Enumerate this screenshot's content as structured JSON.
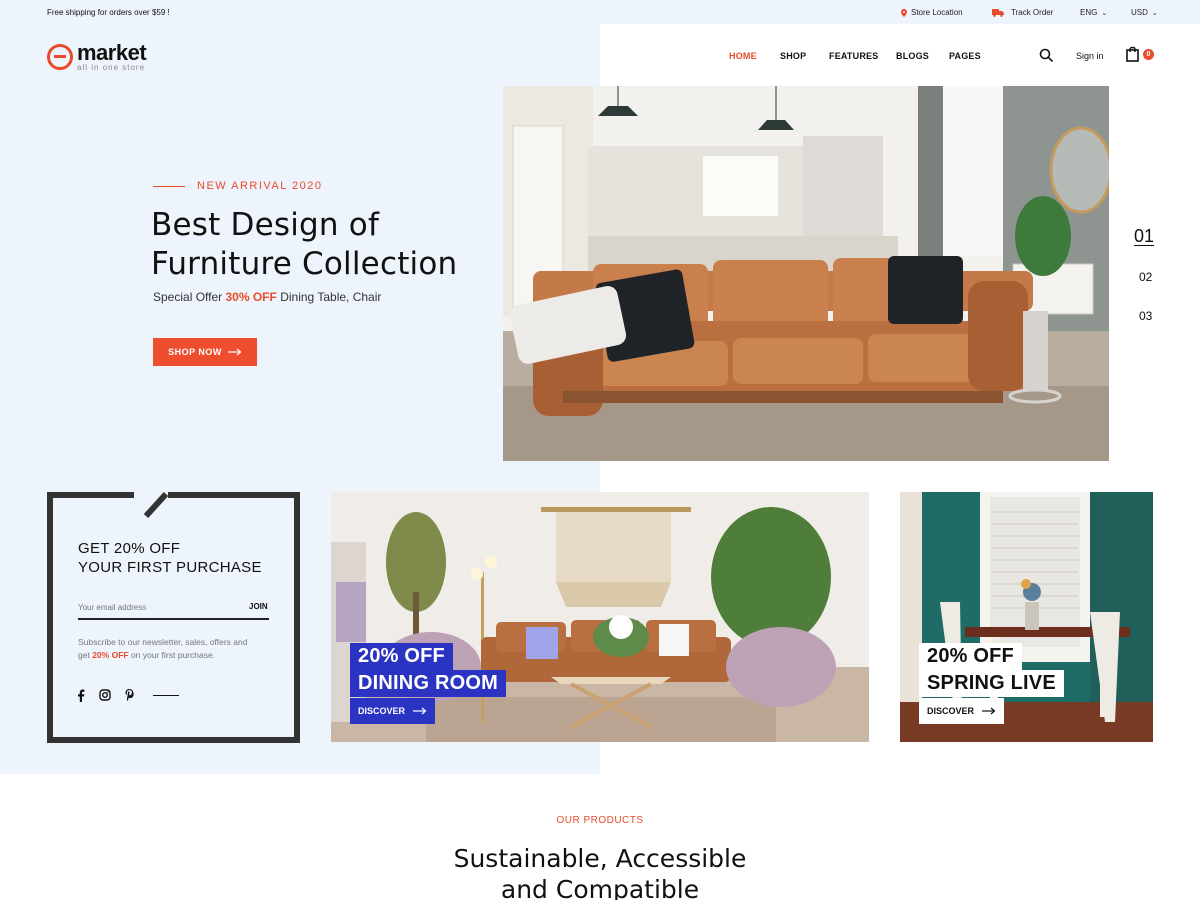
{
  "topbar": {
    "shipping": "Free shipping for orders over $59 !",
    "store_location": "Store Location",
    "track_order": "Track Order",
    "language": "ENG",
    "currency": "USD"
  },
  "header": {
    "logo_word": "market",
    "logo_tagline": "all in one store",
    "nav": [
      "HOME",
      "SHOP",
      "FEATURES",
      "BLOGS",
      "PAGES"
    ],
    "active_nav": "HOME",
    "sign_in": "Sign in",
    "cart_count": "0"
  },
  "hero": {
    "eyebrow": "NEW ARRIVAL 2020",
    "title_line1": "Best Design of",
    "title_line2": "Furniture Collection",
    "subtitle_prefix": "Special Offer",
    "subtitle_highlight": "30% OFF",
    "subtitle_suffix": "Dining Table, Chair",
    "cta": "SHOP NOW",
    "slides": [
      "01",
      "02",
      "03"
    ],
    "active_slide": "01"
  },
  "newsletter": {
    "title_line1": "GET 20% OFF",
    "title_line2": "YOUR FIRST PURCHASE",
    "email_placeholder": "Your email address",
    "join": "JOIN",
    "desc_line1": "Subscribe to our newsletter, sales, offers and",
    "desc_prefix": "get",
    "desc_highlight": "20% OFF",
    "desc_suffix": "on your first purchase.",
    "socials": [
      "facebook-icon",
      "instagram-icon",
      "pinterest-icon"
    ]
  },
  "promos": [
    {
      "line1": "20% OFF",
      "line2": "DINING ROOM",
      "cta": "DISCOVER"
    },
    {
      "line1": "20% OFF",
      "line2": "SPRING LIVE",
      "cta": "DISCOVER"
    }
  ],
  "products": {
    "eyebrow": "OUR PRODUCTS",
    "title_line1": "Sustainable, Accessible",
    "title_line2": "and Compatible"
  },
  "colors": {
    "accent": "#e94b2d",
    "panel_bg": "#edf4fb",
    "promo_blue": "#2b33c2"
  }
}
